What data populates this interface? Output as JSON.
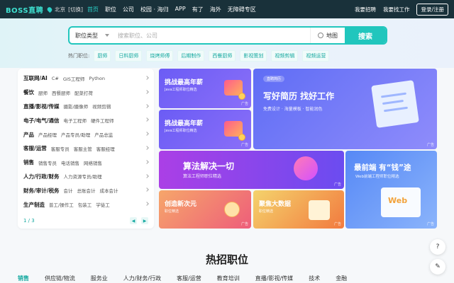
{
  "nav": {
    "logo": "BOSS直聘",
    "city": "北京",
    "city_switch": "[切换]",
    "links": [
      {
        "label": "首页",
        "active": true
      },
      {
        "label": "职位",
        "active": false
      },
      {
        "label": "公司",
        "active": false
      },
      {
        "label": "校园 · 海归",
        "active": false
      },
      {
        "label": "APP",
        "active": false
      },
      {
        "label": "有了",
        "active": false
      },
      {
        "label": "海外",
        "active": false
      },
      {
        "label": "无障碍专区",
        "active": false
      }
    ],
    "recruit": "我要招聘",
    "find_job": "我要找工作",
    "login": "登录/注册"
  },
  "search": {
    "job_type": "职位类型",
    "placeholder": "搜索职位、公司",
    "map": "地图",
    "button": "搜索"
  },
  "hot": {
    "label": "热门职位:",
    "tags": [
      "厨师",
      "日料厨师",
      "烧烤师傅",
      "后期制作",
      "西餐厨师",
      "影视策划",
      "视频剪辑",
      "视频运营"
    ]
  },
  "categories": [
    {
      "main": "互联网/AI",
      "subs": [
        "C#",
        "GIS工程师",
        "Python"
      ]
    },
    {
      "main": "餐饮",
      "subs": [
        "厨师",
        "西餐厨师",
        "配菜打荷"
      ]
    },
    {
      "main": "直播/影视/传媒",
      "subs": [
        "摄影/摄像师",
        "视频剪辑"
      ]
    },
    {
      "main": "电子/电气/通信",
      "subs": [
        "电子工程师",
        "硬件工程师"
      ]
    },
    {
      "main": "产品",
      "subs": [
        "产品经理",
        "产品专员/助理",
        "产品总监"
      ]
    },
    {
      "main": "客服/运营",
      "subs": [
        "客服专员",
        "客服主管",
        "客服经理"
      ]
    },
    {
      "main": "销售",
      "subs": [
        "销售专员",
        "电话销售",
        "网络销售"
      ]
    },
    {
      "main": "人力/行政/财务",
      "subs": [
        "人力资源专员/助理"
      ]
    },
    {
      "main": "财务/审计/税务",
      "subs": [
        "会计",
        "总账会计",
        "成本会计"
      ]
    },
    {
      "main": "生产制造",
      "subs": [
        "普工/操作工",
        "包装工",
        "学徒工"
      ]
    }
  ],
  "pager": {
    "text": "1 / 3",
    "prev": "◀",
    "next": "▶"
  },
  "ads": {
    "t1": {
      "title": "挑战最高年薪",
      "sub": "Java工程师职位精选",
      "ad": "广告"
    },
    "t2": {
      "title": "挑战最高年薪",
      "sub": "Java工程师职位精选",
      "ad": "广告"
    },
    "t3": {
      "badge": "直聘简历",
      "title": "写好简历 找好工作",
      "sub": "免费设计 · 海量模板 · 智能润色",
      "ad": "广告"
    },
    "t4": {
      "title": "算法解决一切",
      "sub": "算法工程师职位精选",
      "ad": "广告"
    },
    "t5": {
      "title": "最前端 有“钱”途",
      "sub": "Web前端工程师职位精选",
      "web": "Web",
      "ad": "广告"
    },
    "t6": {
      "title": "创造新次元",
      "sub": "职位精选",
      "ad": "广告"
    },
    "t7": {
      "title": "聚焦大数据",
      "sub": "职位精选",
      "ad": "广告"
    }
  },
  "float": {
    "help": "?",
    "feedback": "✎"
  },
  "section": {
    "title": "热招职位",
    "tabs": [
      {
        "label": "销售",
        "active": true
      },
      {
        "label": "供应链/物流",
        "active": false
      },
      {
        "label": "服务业",
        "active": false
      },
      {
        "label": "人力/财务/行政",
        "active": false
      },
      {
        "label": "客服/运营",
        "active": false
      },
      {
        "label": "教育培训",
        "active": false
      },
      {
        "label": "直播/影视/传媒",
        "active": false
      },
      {
        "label": "技术",
        "active": false
      },
      {
        "label": "金融",
        "active": false
      }
    ]
  },
  "colors": {
    "accent": "#21c6bd",
    "nav_bg": "#19313a"
  }
}
